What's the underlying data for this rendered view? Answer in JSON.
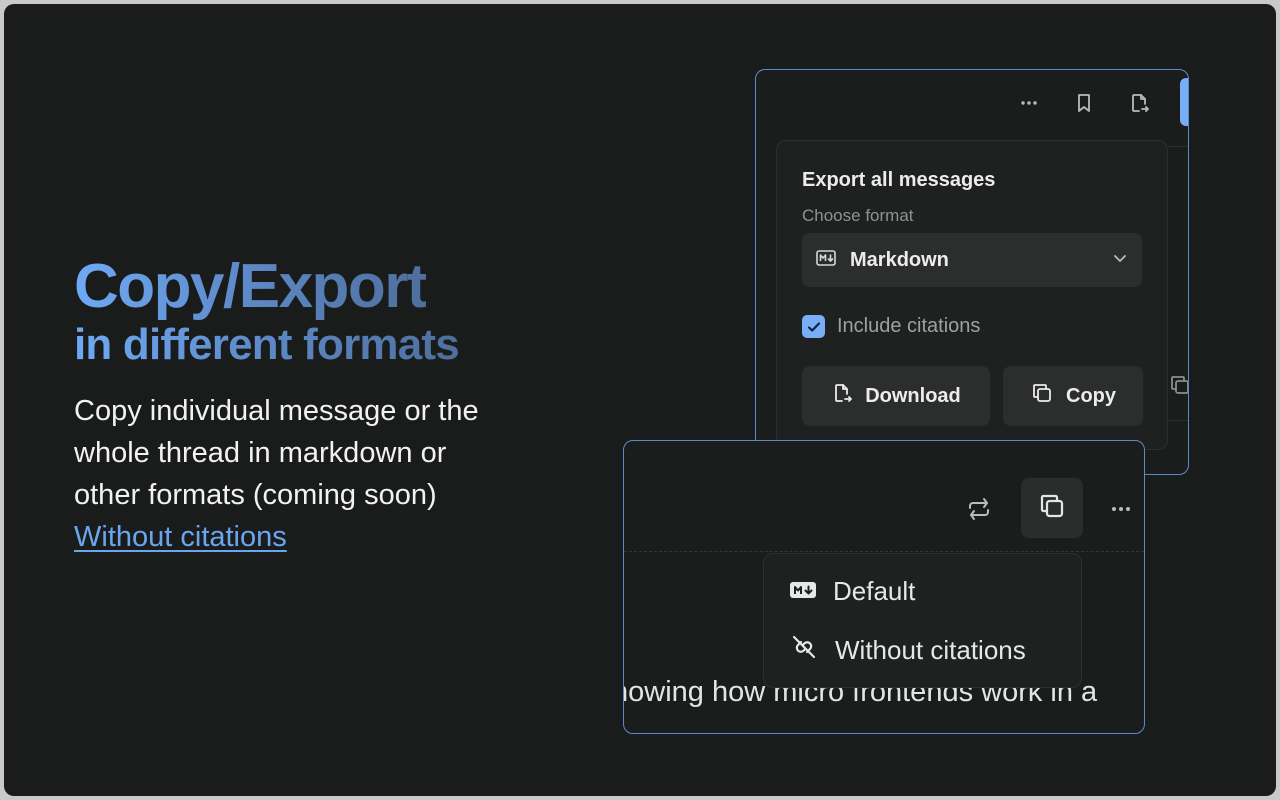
{
  "hero": {
    "title": "Copy/Export",
    "subtitle": "in different formats",
    "description_lines": [
      "Copy individual message or the",
      "whole thread in markdown or",
      "other formats (coming soon)"
    ],
    "link": "Without citations"
  },
  "export_panel": {
    "toolbar_icons": [
      "more-icon",
      "bookmark-icon",
      "export-file-icon"
    ],
    "title": "Export all messages",
    "format_label": "Choose format",
    "format_value": "Markdown",
    "include_citations_label": "Include citations",
    "include_citations_checked": true,
    "download_label": "Download",
    "copy_label": "Copy"
  },
  "copy_panel": {
    "toolbar_icons": [
      "regenerate-icon",
      "copy-icon",
      "more-icon"
    ],
    "menu": [
      {
        "label": "Default",
        "icon": "markdown-icon"
      },
      {
        "label": "Without citations",
        "icon": "link-off-icon"
      }
    ],
    "background_text": "howing how micro frontends work in a"
  },
  "colors": {
    "accent": "#78aef7",
    "panel_border": "#5e89c8",
    "background": "#1a1c1c"
  }
}
